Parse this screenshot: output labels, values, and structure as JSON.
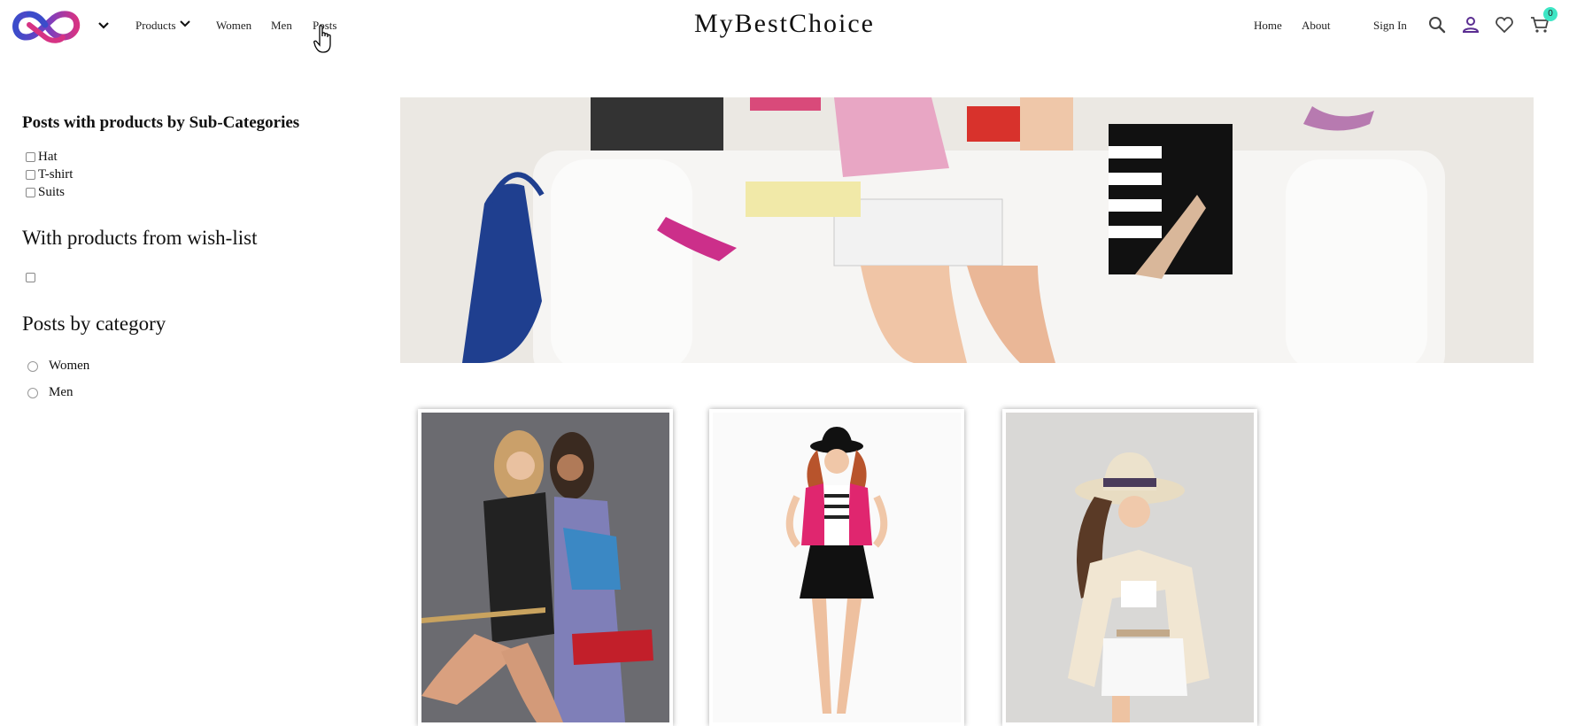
{
  "header": {
    "brand": "MyBestChoice",
    "nav_left": {
      "products": "Products",
      "women": "Women",
      "men": "Men",
      "posts": "Posts"
    },
    "nav_right": {
      "home": "Home",
      "about": "About",
      "sign_in": "Sign In"
    },
    "icons": [
      "search-icon",
      "user-icon",
      "heart-icon",
      "cart-icon"
    ],
    "cart_count": "0",
    "colors": {
      "logo_pink": "#d63384",
      "logo_blue": "#3b4cca",
      "badge": "#3ee6c5"
    }
  },
  "sidebar": {
    "subcategories_title": "Posts with products by Sub-Categories",
    "subcategories": [
      "Hat",
      "T-shirt",
      "Suits"
    ],
    "wishlist_title": "With products from wish-list",
    "category_title": "Posts by category",
    "categories": [
      "Women",
      "Men"
    ]
  }
}
